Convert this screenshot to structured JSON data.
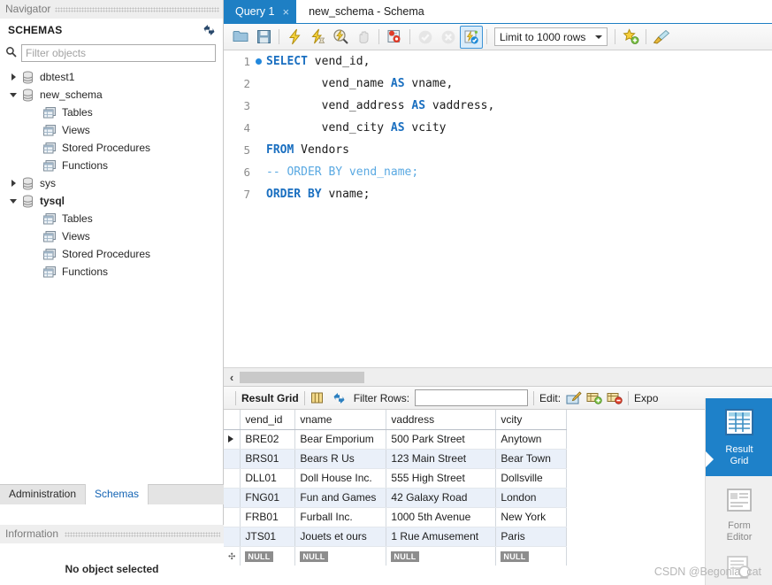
{
  "navigator": {
    "header": "Navigator",
    "schemas_title": "SCHEMAS",
    "refresh_icon": "refresh-icon",
    "search_icon": "search-icon",
    "filter_placeholder": "Filter objects",
    "filter_value": "",
    "tree": [
      {
        "label": "dbtest1",
        "level": 0,
        "expanded": false,
        "bold": false,
        "icon": "database-icon"
      },
      {
        "label": "new_schema",
        "level": 0,
        "expanded": true,
        "bold": false,
        "icon": "database-icon"
      },
      {
        "label": "Tables",
        "level": 1,
        "expanded": null,
        "bold": false,
        "icon": "table-folder-icon"
      },
      {
        "label": "Views",
        "level": 1,
        "expanded": null,
        "bold": false,
        "icon": "view-folder-icon"
      },
      {
        "label": "Stored Procedures",
        "level": 1,
        "expanded": null,
        "bold": false,
        "icon": "procedure-folder-icon"
      },
      {
        "label": "Functions",
        "level": 1,
        "expanded": null,
        "bold": false,
        "icon": "function-folder-icon"
      },
      {
        "label": "sys",
        "level": 0,
        "expanded": false,
        "bold": false,
        "icon": "database-icon"
      },
      {
        "label": "tysql",
        "level": 0,
        "expanded": true,
        "bold": true,
        "icon": "database-icon"
      },
      {
        "label": "Tables",
        "level": 1,
        "expanded": null,
        "bold": false,
        "icon": "table-folder-icon"
      },
      {
        "label": "Views",
        "level": 1,
        "expanded": null,
        "bold": false,
        "icon": "view-folder-icon"
      },
      {
        "label": "Stored Procedures",
        "level": 1,
        "expanded": null,
        "bold": false,
        "icon": "procedure-folder-icon"
      },
      {
        "label": "Functions",
        "level": 1,
        "expanded": null,
        "bold": false,
        "icon": "function-folder-icon"
      }
    ],
    "tabs": [
      {
        "label": "Administration",
        "active": false
      },
      {
        "label": "Schemas",
        "active": true
      }
    ],
    "information": {
      "header": "Information",
      "body": "No object selected"
    }
  },
  "tabstrip": {
    "active_tab": "Query 1",
    "close_glyph": "×",
    "inactive_tab": "new_schema - Schema"
  },
  "toolbar": {
    "buttons": [
      {
        "name": "open-script-icon",
        "enabled": true,
        "selected": false
      },
      {
        "name": "save-script-icon",
        "enabled": true,
        "selected": false
      },
      {
        "name": "execute-statement-icon",
        "enabled": true,
        "selected": false
      },
      {
        "name": "execute-current-icon",
        "enabled": true,
        "selected": false
      },
      {
        "name": "explain-query-icon",
        "enabled": true,
        "selected": false
      },
      {
        "name": "stop-query-icon",
        "enabled": false,
        "selected": false
      },
      {
        "name": "toggle-stop-on-error-icon",
        "enabled": true,
        "selected": false
      },
      {
        "name": "commit-icon",
        "enabled": false,
        "selected": false
      },
      {
        "name": "rollback-icon",
        "enabled": false,
        "selected": false
      },
      {
        "name": "autocommit-icon",
        "enabled": true,
        "selected": true
      }
    ],
    "limit_label": "Limit to 1000 rows",
    "favorite_icon": "add-snippet-icon",
    "beautify_icon": "beautify-sql-icon"
  },
  "editor": {
    "breakpoint_marker": "statement-marker",
    "lines": [
      {
        "num": "1",
        "marker": true,
        "tokens": [
          {
            "t": "kw",
            "v": "SELECT"
          },
          {
            "t": "id",
            "v": " vend_id,"
          }
        ]
      },
      {
        "num": "2",
        "marker": false,
        "tokens": [
          {
            "t": "id",
            "v": "        vend_name "
          },
          {
            "t": "kw",
            "v": "AS"
          },
          {
            "t": "id",
            "v": " vname,"
          }
        ]
      },
      {
        "num": "3",
        "marker": false,
        "tokens": [
          {
            "t": "id",
            "v": "        vend_address "
          },
          {
            "t": "kw",
            "v": "AS"
          },
          {
            "t": "id",
            "v": " vaddress,"
          }
        ]
      },
      {
        "num": "4",
        "marker": false,
        "tokens": [
          {
            "t": "id",
            "v": "        vend_city "
          },
          {
            "t": "kw",
            "v": "AS"
          },
          {
            "t": "id",
            "v": " vcity"
          }
        ]
      },
      {
        "num": "5",
        "marker": false,
        "tokens": [
          {
            "t": "kw",
            "v": "FROM"
          },
          {
            "t": "id",
            "v": " Vendors"
          }
        ]
      },
      {
        "num": "6",
        "marker": false,
        "tokens": [
          {
            "t": "cmt",
            "v": "-- ORDER BY vend_name;"
          }
        ]
      },
      {
        "num": "7",
        "marker": false,
        "tokens": [
          {
            "t": "kw",
            "v": "ORDER BY"
          },
          {
            "t": "id",
            "v": " vname;"
          }
        ]
      }
    ]
  },
  "hscroll": {
    "back_glyph": "‹"
  },
  "results_toolbar": {
    "result_grid_label": "Result Grid",
    "grid_icon": "field-types-icon",
    "refresh_icon": "refresh-grid-icon",
    "filter_rows_label": "Filter Rows:",
    "filter_rows_value": "",
    "edit_label": "Edit:",
    "edit_icon": "edit-row-icon",
    "insert_icon": "insert-row-icon",
    "delete_icon": "delete-row-icon",
    "export_label": "Expo"
  },
  "grid": {
    "columns": [
      "vend_id",
      "vname",
      "vaddress",
      "vcity"
    ],
    "rows": [
      {
        "selected": true,
        "cells": [
          "BRE02",
          "Bear Emporium",
          "500 Park Street",
          "Anytown"
        ]
      },
      {
        "selected": false,
        "cells": [
          "BRS01",
          "Bears R Us",
          "123 Main Street",
          "Bear Town"
        ]
      },
      {
        "selected": false,
        "cells": [
          "DLL01",
          "Doll House Inc.",
          "555 High Street",
          "Dollsville"
        ]
      },
      {
        "selected": false,
        "cells": [
          "FNG01",
          "Fun and Games",
          "42 Galaxy Road",
          "London"
        ]
      },
      {
        "selected": false,
        "cells": [
          "FRB01",
          "Furball Inc.",
          "1000 5th Avenue",
          "New York"
        ]
      },
      {
        "selected": false,
        "cells": [
          "JTS01",
          "Jouets et ours",
          "1 Rue Amusement",
          "Paris"
        ]
      }
    ],
    "new_row_label": "NULL"
  },
  "side_panel": {
    "items": [
      {
        "label_line1": "Result",
        "label_line2": "Grid",
        "icon": "result-grid-icon",
        "active": true
      },
      {
        "label_line1": "Form",
        "label_line2": "Editor",
        "icon": "form-editor-icon",
        "active": false
      },
      {
        "label_line1": "",
        "label_line2": "",
        "icon": "field-types-icon",
        "active": false
      }
    ]
  },
  "watermark": "CSDN @Begonia_cat",
  "colors": {
    "accent_blue": "#1e7fc4",
    "tab_active_blue": "#1e81c9",
    "keyword_blue": "#1a6fc0",
    "comment_blue": "#5aa9e2",
    "alt_row": "#eaf0f9",
    "toolbar_bg": "#f0f0f0",
    "null_badge": "#8d8d8d"
  }
}
